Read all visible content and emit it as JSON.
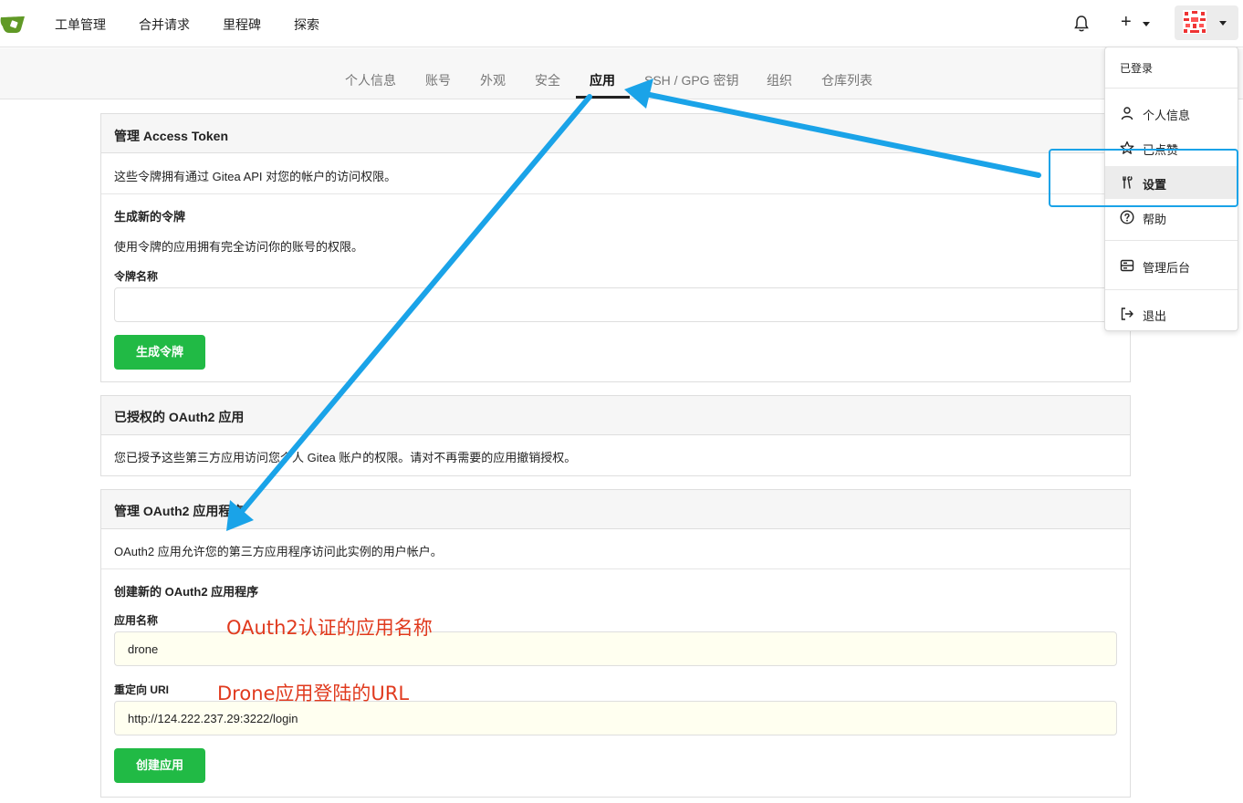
{
  "nav": {
    "items": [
      "工单管理",
      "合并请求",
      "里程碑",
      "探索"
    ],
    "plus_label": "+"
  },
  "tabs": [
    {
      "label": "个人信息"
    },
    {
      "label": "账号"
    },
    {
      "label": "外观"
    },
    {
      "label": "安全"
    },
    {
      "label": "应用",
      "active": true
    },
    {
      "label": "SSH / GPG 密钥"
    },
    {
      "label": "组织"
    },
    {
      "label": "仓库列表"
    }
  ],
  "access_token": {
    "title": "管理 Access Token",
    "description": "这些令牌拥有通过 Gitea API 对您的帐户的访问权限。",
    "generate_heading": "生成新的令牌",
    "generate_desc": "使用令牌的应用拥有完全访问你的账号的权限。",
    "token_name_label": "令牌名称",
    "token_name_value": "",
    "generate_button": "生成令牌"
  },
  "authorized_oauth": {
    "title": "已授权的 OAuth2 应用",
    "description": "您已授予这些第三方应用访问您个人 Gitea 账户的权限。请对不再需要的应用撤销授权。"
  },
  "manage_oauth": {
    "title": "管理 OAuth2 应用程序",
    "description": "OAuth2 应用允许您的第三方应用程序访问此实例的用户帐户。",
    "create_heading": "创建新的 OAuth2 应用程序",
    "app_name_label": "应用名称",
    "app_name_value": "drone",
    "redirect_label": "重定向 URI",
    "redirect_value": "http://124.222.237.29:3222/login",
    "create_button": "创建应用"
  },
  "annotations": {
    "app_name_note": "OAuth2认证的应用名称",
    "redirect_note": "Drone应用登陆的URL"
  },
  "user_menu": {
    "signed_in_as": "已登录",
    "items": [
      {
        "label": "个人信息",
        "icon": "person-icon"
      },
      {
        "label": "已点赞",
        "icon": "star-icon"
      },
      {
        "label": "设置",
        "icon": "tools-icon",
        "active": true
      },
      {
        "label": "帮助",
        "icon": "question-icon"
      },
      {
        "label": "管理后台",
        "icon": "server-icon"
      },
      {
        "label": "退出",
        "icon": "sign-out-icon"
      }
    ]
  },
  "colors": {
    "accent_green": "#21ba45",
    "annotation_red": "#e03a1e",
    "arrow_blue": "#1aa3e8",
    "input_filled_bg": "#fffff0"
  }
}
